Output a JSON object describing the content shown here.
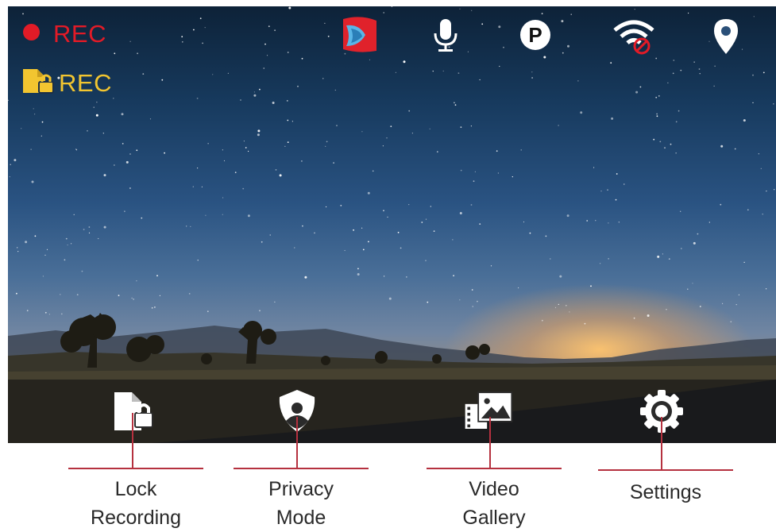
{
  "status": {
    "recording_label": "REC",
    "locked_recording_label": "REC",
    "rec_color": "#e21b27",
    "locked_color": "#f2c530"
  },
  "top_icons": [
    "app-logo-icon",
    "microphone-icon",
    "parking-icon",
    "wifi-off-icon",
    "location-pin-icon"
  ],
  "toolbar": {
    "buttons": [
      {
        "name": "lock-recording-button",
        "icon": "file-lock-icon",
        "caption_line1": "Lock",
        "caption_line2": "Recording"
      },
      {
        "name": "privacy-mode-button",
        "icon": "shield-user-icon",
        "caption_line1": "Privacy",
        "caption_line2": "Mode"
      },
      {
        "name": "video-gallery-button",
        "icon": "gallery-icon",
        "caption_line1": "Video",
        "caption_line2": "Gallery"
      },
      {
        "name": "settings-button",
        "icon": "gear-icon",
        "caption_line1": "Settings",
        "caption_line2": ""
      }
    ]
  },
  "callout_color": "#b5313f"
}
